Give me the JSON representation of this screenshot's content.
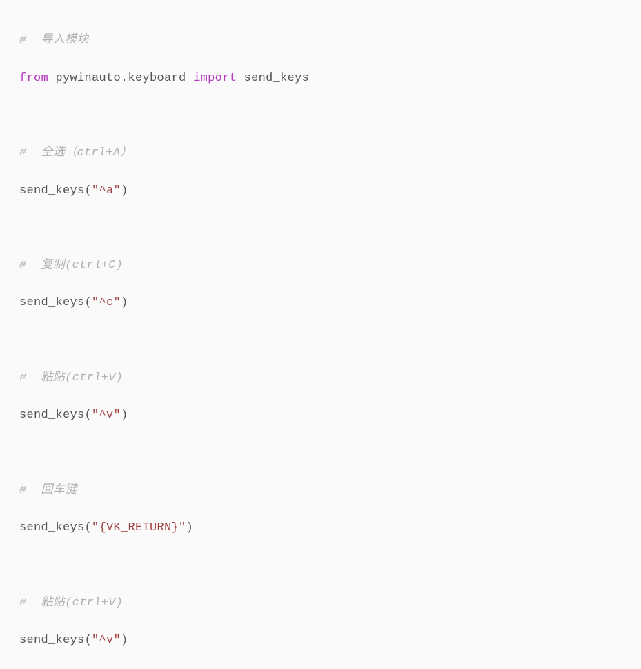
{
  "code": {
    "comment1": "#  导入模块",
    "kw_from": "from",
    "module": "pywinauto.keyboard",
    "kw_import": "import",
    "import_name": "send_keys",
    "comment2": "#  全选（ctrl+A）",
    "call1_fn": "send_keys",
    "call1_open": "(",
    "call1_arg": "\"^a\"",
    "call1_close": ")",
    "comment3": "#  复制(ctrl+C)",
    "call2_fn": "send_keys",
    "call2_open": "(",
    "call2_arg": "\"^c\"",
    "call2_close": ")",
    "comment4": "#  粘贴(ctrl+V)",
    "call3_fn": "send_keys",
    "call3_open": "(",
    "call3_arg": "\"^v\"",
    "call3_close": ")",
    "comment5": "#  回车键",
    "call4_fn": "send_keys",
    "call4_open": "(",
    "call4_arg": "\"{VK_RETURN}\"",
    "call4_close": ")",
    "comment6": "#  粘贴(ctrl+V)",
    "call5_fn": "send_keys",
    "call5_open": "(",
    "call5_arg": "\"^v\"",
    "call5_close": ")"
  }
}
